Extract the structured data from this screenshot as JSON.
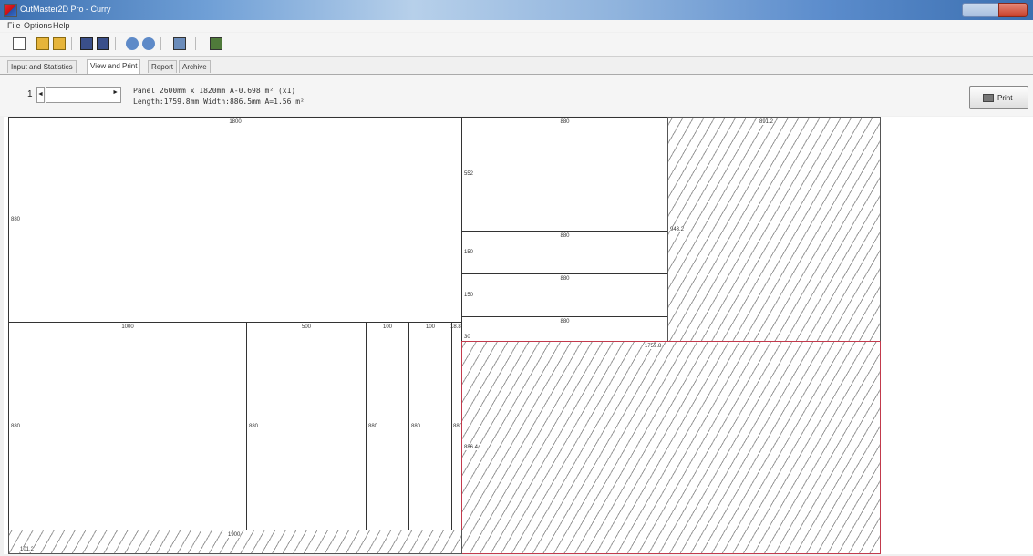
{
  "window": {
    "title": "CutMaster2D Pro - Curry"
  },
  "menu": [
    "File",
    "Options",
    "Help"
  ],
  "toolbar": {
    "icons": [
      "new-icon",
      "open-icon",
      "open-recent-icon",
      "save-icon",
      "save-as-icon",
      "optimize-icon",
      "undo-icon",
      "print-setup-icon",
      "export-icon"
    ]
  },
  "tabs": [
    "Input and Statistics",
    "View and Print",
    "Report",
    "Archive"
  ],
  "active_tab": "View and Print",
  "panel": {
    "page_number": "1",
    "info_line1": "Panel 2600mm x 1820mm A-0.698 m² (x1)",
    "info_line2": "Length:1759.8mm Width:886.5mm A=1.56 m²",
    "print_label": "Print"
  },
  "layout": {
    "top_big": {
      "w": "1800",
      "h": "880"
    },
    "mid_a": {
      "w": "880",
      "h": "552"
    },
    "mid_b": {
      "w": "880",
      "h": "150"
    },
    "mid_c": {
      "w": "880",
      "h": "150"
    },
    "mid_d": {
      "w": "880",
      "h": "30"
    },
    "waste_top": {
      "w": "891.2",
      "h": "943.2"
    },
    "bot_1": {
      "w": "1000",
      "h": "880"
    },
    "bot_2": {
      "w": "500",
      "h": "880"
    },
    "bot_3": {
      "w": "100",
      "h": "880"
    },
    "bot_4": {
      "w": "100",
      "h": "880"
    },
    "bot_5": {
      "w": "18.8",
      "h": "880"
    },
    "waste_big": {
      "w": "1759.8",
      "h": "886.4"
    },
    "waste_bottom": {
      "w": "1900",
      "h": "101.2"
    }
  }
}
